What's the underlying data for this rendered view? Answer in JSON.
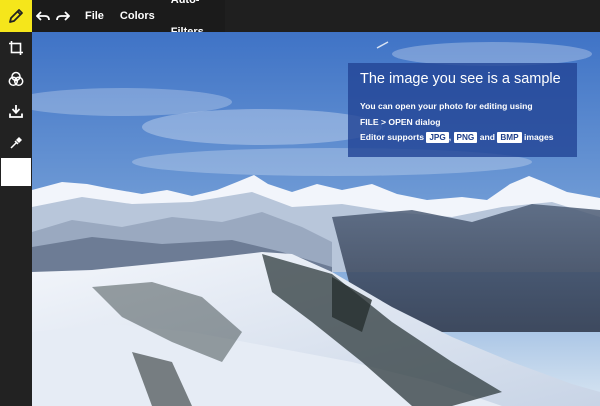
{
  "toolbar": {
    "undo_icon": "undo-arrow-icon",
    "redo_icon": "redo-arrow-icon",
    "menus": [
      "File",
      "Colors",
      "Auto-Filters"
    ]
  },
  "sidebar": {
    "tools": [
      {
        "icon": "pencil-icon",
        "active": true
      },
      {
        "icon": "crop-icon"
      },
      {
        "icon": "color-circles-icon"
      },
      {
        "icon": "download-icon"
      },
      {
        "icon": "eyedropper-icon"
      }
    ],
    "color_swatch": "#ffffff"
  },
  "sample_panel": {
    "title": "The image you see is a sample",
    "line1": "You can open your photo for editing using",
    "line2": "FILE > OPEN dialog",
    "line3_prefix": "Editor supports",
    "formats": [
      "JPG",
      "PNG",
      "BMP"
    ],
    "joiner_comma": ",",
    "joiner_and": "and",
    "line3_suffix": "images"
  },
  "colors": {
    "active_tool": "#f5e61b",
    "panel": "#234696"
  }
}
